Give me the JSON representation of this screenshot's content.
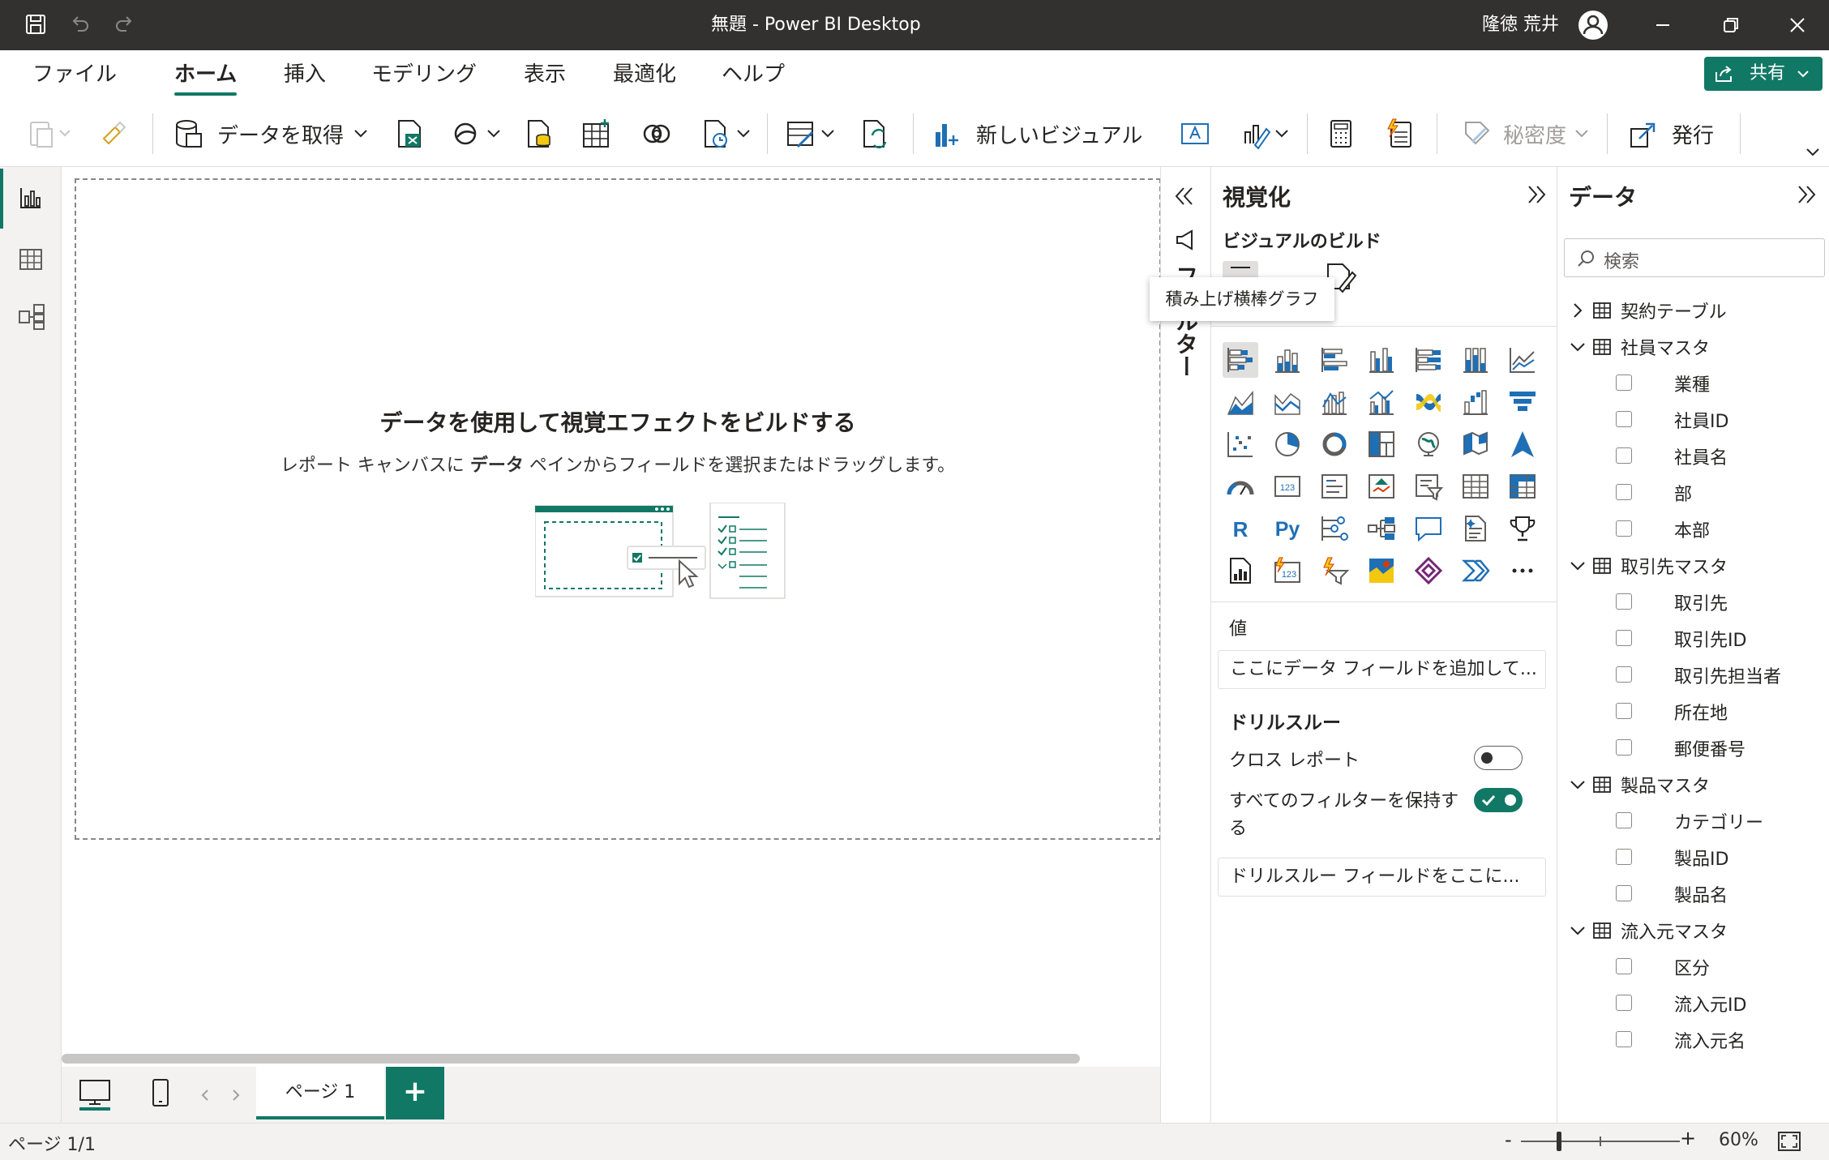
{
  "titlebar": {
    "title": "無題 - Power BI Desktop",
    "user_name": "隆徳 荒井"
  },
  "menu": {
    "items": [
      "ファイル",
      "ホーム",
      "挿入",
      "モデリング",
      "表示",
      "最適化",
      "ヘルプ"
    ],
    "active": "ホーム",
    "share_label": "共有"
  },
  "ribbon": {
    "get_data_label": "データを取得",
    "new_visual_label": "新しいビジュアル",
    "sensitivity_label": "秘密度",
    "publish_label": "発行"
  },
  "canvas": {
    "heading": "データを使用して視覚エフェクトをビルドする",
    "sub_pre": "レポート キャンバスに ",
    "sub_bold": "データ",
    "sub_post": " ペインからフィールドを選択またはドラッグします。"
  },
  "pages": {
    "tab_label": "ページ 1",
    "add_label": "+"
  },
  "status": {
    "page_info": "ページ 1/1",
    "zoom_minus": "-",
    "zoom_plus": "+",
    "zoom_level": "60%",
    "zoom_fraction": 0.24
  },
  "filters_strip": {
    "label": "フィルター"
  },
  "viz": {
    "title": "視覚化",
    "build_label": "ビジュアルのビルド",
    "tooltip": "積み上げ横棒グラフ",
    "values_label": "値",
    "values_placeholder": "ここにデータ フィールドを追加して...",
    "drill_title": "ドリルスルー",
    "cross_report_label": "クロス レポート",
    "cross_report_on": false,
    "keep_filters_label_1": "すべてのフィルターを保持す",
    "keep_filters_label_2": "る",
    "keep_filters_on": true,
    "drill_placeholder": "ドリルスルー フィールドをここに..."
  },
  "data_pane": {
    "title": "データ",
    "search_placeholder": "検索",
    "tables": [
      {
        "name": "契約テーブル",
        "expanded": false,
        "fields": []
      },
      {
        "name": "社員マスタ",
        "expanded": true,
        "fields": [
          "業種",
          "社員ID",
          "社員名",
          "部",
          "本部"
        ]
      },
      {
        "name": "取引先マスタ",
        "expanded": true,
        "fields": [
          "取引先",
          "取引先ID",
          "取引先担当者",
          "所在地",
          "郵便番号"
        ]
      },
      {
        "name": "製品マスタ",
        "expanded": true,
        "fields": [
          "カテゴリー",
          "製品ID",
          "製品名"
        ]
      },
      {
        "name": "流入元マスタ",
        "expanded": true,
        "fields": [
          "区分",
          "流入元ID",
          "流入元名"
        ]
      }
    ]
  },
  "colors": {
    "accent": "#117865",
    "titlebar": "#323130",
    "chart_blue": "#1f6fb5",
    "chart_yellow": "#f2c811"
  }
}
